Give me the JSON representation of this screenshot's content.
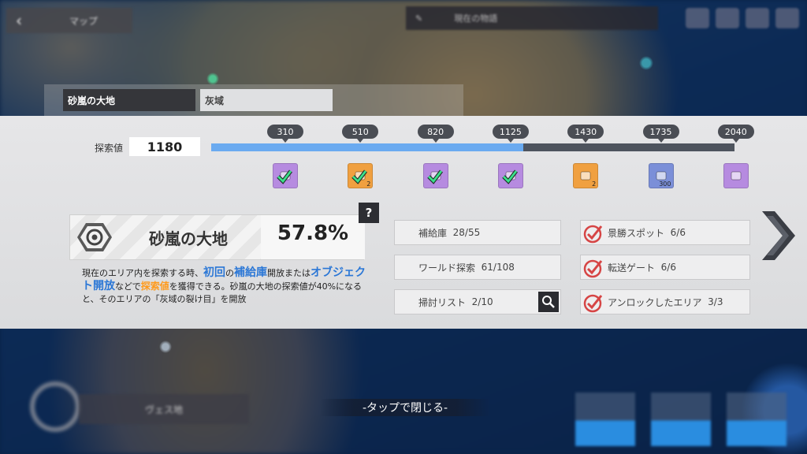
{
  "top": {
    "back_label": "マップ",
    "center_text": "現在の物語"
  },
  "tabs": [
    {
      "label": "砂嵐の大地"
    },
    {
      "label": "灰域"
    }
  ],
  "explore": {
    "label": "探索値",
    "value": "1180",
    "progress_fraction": 0.596,
    "milestones": [
      "310",
      "510",
      "820",
      "1125",
      "1430",
      "1735",
      "2040"
    ],
    "rewards": [
      {
        "icon": "supply-crate-icon",
        "claimed": true,
        "qty": "",
        "color": "#b68be0"
      },
      {
        "icon": "material-icon",
        "claimed": true,
        "qty": "2",
        "color": "#f0a040"
      },
      {
        "icon": "supply-crate-icon",
        "claimed": true,
        "qty": "",
        "color": "#b68be0"
      },
      {
        "icon": "supply-crate-icon",
        "claimed": true,
        "qty": "",
        "color": "#b68be0"
      },
      {
        "icon": "book-icon",
        "claimed": false,
        "qty": "2",
        "color": "#f0a040"
      },
      {
        "icon": "currency-icon",
        "claimed": false,
        "qty": "300",
        "color": "#7b8fd8"
      },
      {
        "icon": "chip-icon",
        "claimed": false,
        "qty": "",
        "color": "#b68be0"
      }
    ]
  },
  "area": {
    "name": "砂嵐の大地",
    "percent": "57.8%",
    "help": "?",
    "desc": {
      "p1": "現在のエリア内を探索する時、",
      "hl1": "初回",
      "p2": "の",
      "hl2": "補給庫",
      "p3": "開放または",
      "hl3": "オブジェクト開放",
      "p4": "などで",
      "hl4": "探索値",
      "p5": "を獲得できる。砂嵐の大地の探索値が40%になると、そのエリアの「灰域の裂け目」を開放"
    }
  },
  "stats": [
    {
      "label": "補給庫",
      "value": "28/55"
    },
    {
      "label": "ワールド探索",
      "value": "61/108"
    },
    {
      "label": "掃討リスト",
      "value": "2/10"
    }
  ],
  "completed": [
    {
      "label": "景勝スポット",
      "value": "6/6"
    },
    {
      "label": "転送ゲート",
      "value": "6/6"
    },
    {
      "label": "アンロックしたエリア",
      "value": "3/3"
    }
  ],
  "close_hint": "-タップで閉じる-",
  "bottom": {
    "left_label": "ヴェス地"
  },
  "colors": {
    "progress_fill": "#6aaaf0",
    "progress_track": "#4e545e",
    "highlight_blue": "#2b77d6",
    "highlight_orange": "#ff9a1c",
    "check_red": "#d64545"
  }
}
